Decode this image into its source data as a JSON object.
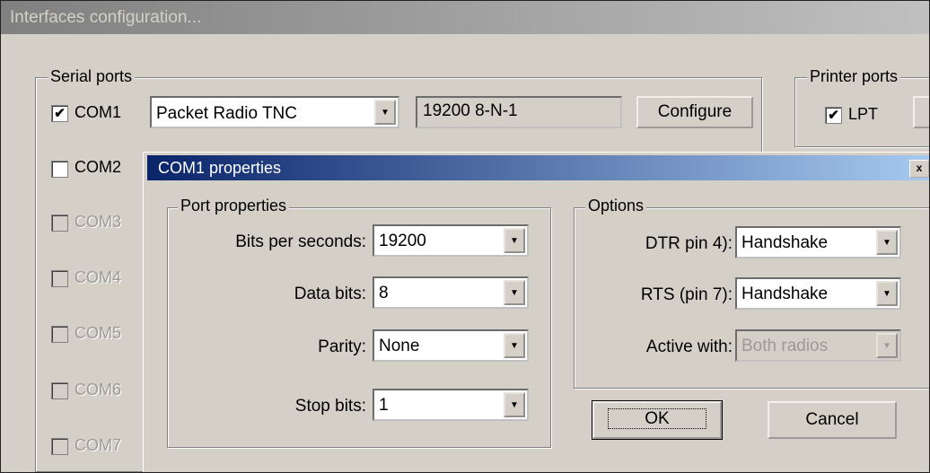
{
  "main_window": {
    "title": "Interfaces configuration...",
    "serial_ports": {
      "legend": "Serial ports",
      "com1": {
        "label": "COM1",
        "checked": true,
        "device": "Packet Radio TNC",
        "settings": "19200 8-N-1",
        "configure_label": "Configure"
      },
      "com2": {
        "label": "COM2",
        "checked": false
      },
      "com3": {
        "label": "COM3"
      },
      "com4": {
        "label": "COM4"
      },
      "com5": {
        "label": "COM5"
      },
      "com6": {
        "label": "COM6"
      },
      "com7": {
        "label": "COM7"
      }
    },
    "printer_ports": {
      "legend": "Printer ports",
      "lpt": {
        "label": "LPT",
        "checked": true
      }
    }
  },
  "dialog": {
    "title": "COM1 properties",
    "close_glyph": "x",
    "port_properties": {
      "legend": "Port properties",
      "bits_per_second": {
        "label": "Bits per seconds:",
        "value": "19200"
      },
      "data_bits": {
        "label": "Data bits:",
        "value": "8"
      },
      "parity": {
        "label": "Parity:",
        "value": "None"
      },
      "stop_bits": {
        "label": "Stop bits:",
        "value": "1"
      }
    },
    "options": {
      "legend": "Options",
      "dtr": {
        "label": "DTR pin 4):",
        "value": "Handshake"
      },
      "rts": {
        "label": "RTS (pin 7):",
        "value": "Handshake"
      },
      "active_with": {
        "label": "Active with:",
        "value": "Both radios"
      }
    },
    "ok_label": "OK",
    "cancel_label": "Cancel"
  },
  "glyphs": {
    "check": "✔",
    "dropdown": "▼"
  },
  "colors": {
    "title_gradient_start": "#0a246a",
    "title_gradient_end": "#a6caf0",
    "face": "#d4d0c8"
  }
}
